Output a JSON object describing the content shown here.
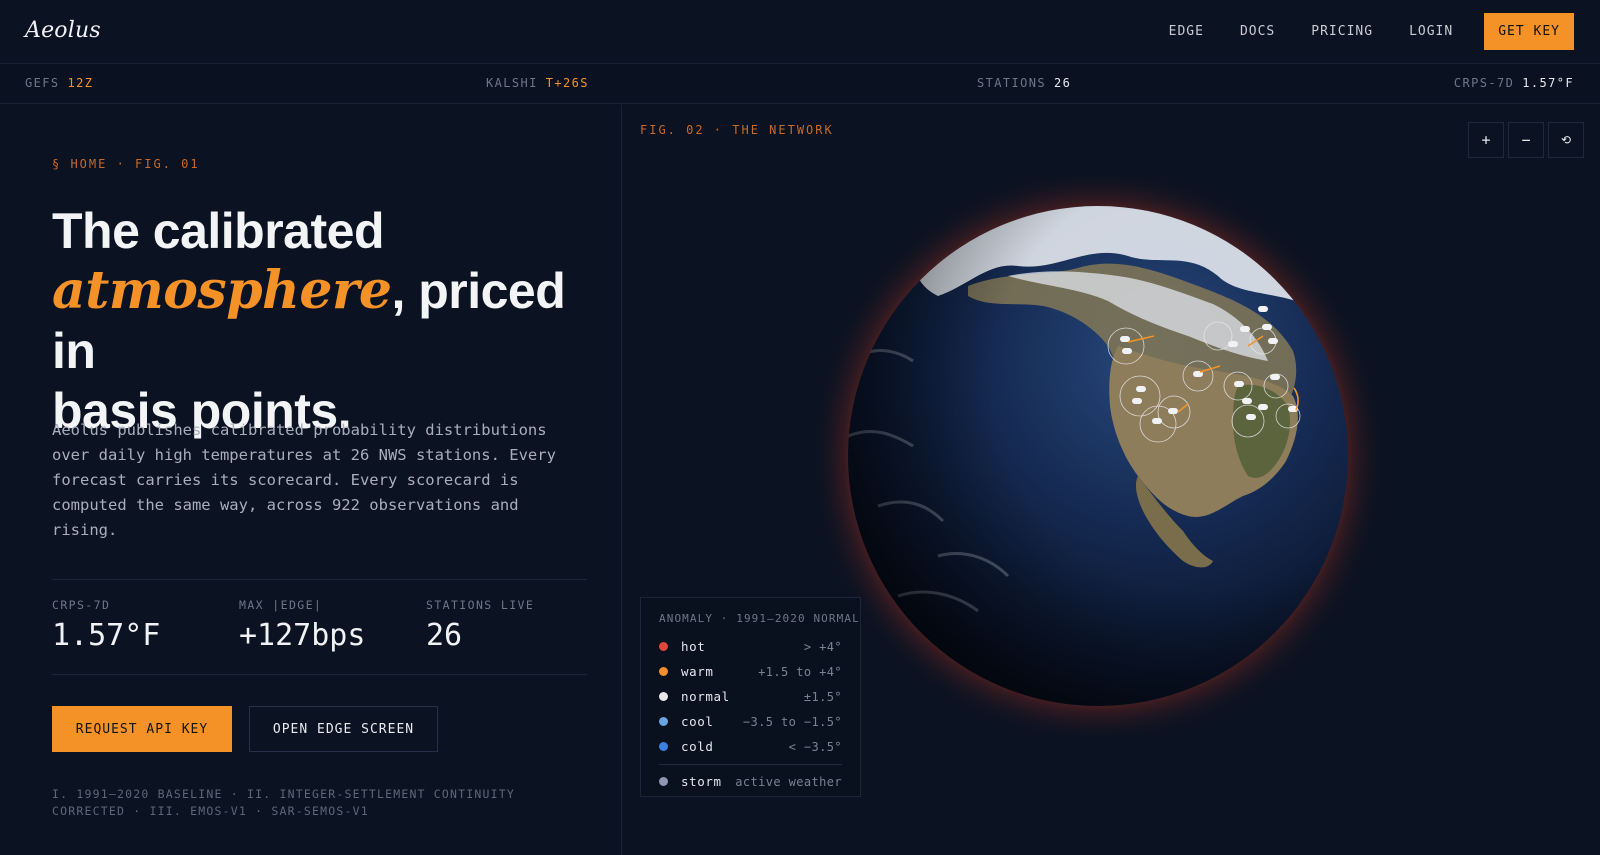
{
  "brand": {
    "logo": "Aeolus"
  },
  "nav": {
    "links": [
      "EDGE",
      "DOCS",
      "PRICING",
      "LOGIN"
    ],
    "cta": "GET KEY",
    "accent_color": "#f59227"
  },
  "ticker": [
    {
      "label": "GEFS",
      "value": "12Z"
    },
    {
      "label": "KALSHI",
      "value": "T+26S"
    },
    {
      "label": "STATIONS",
      "value": "26"
    },
    {
      "label": "CRPS-7D",
      "value": "1.57°F"
    }
  ],
  "hero": {
    "eyebrow": "§ HOME · FIG. 01",
    "headline_line1": "The calibrated",
    "headline_accent": "atmosphere",
    "headline_line2": ", priced in",
    "headline_line3": "basis points.",
    "lede": "Aeolus publishes calibrated probability distributions over daily high temperatures at 26 NWS stations. Every forecast carries its scorecard. Every scorecard is computed the same way, across 922 observations and rising.",
    "stats": [
      {
        "label": "CRPS-7D",
        "value": "1.57°F"
      },
      {
        "label": "MAX |EDGE|",
        "value": "+127bps"
      },
      {
        "label": "STATIONS LIVE",
        "value": "26"
      }
    ],
    "primary_button": "REQUEST API KEY",
    "secondary_button": "OPEN EDGE SCREEN",
    "footnote": "I. 1991–2020 BASELINE · II. INTEGER-SETTLEMENT CONTINUITY CORRECTED · III. EMOS-V1 · SAR-SEMOS-V1"
  },
  "map": {
    "fig_label": "FIG. 02 · THE NETWORK",
    "controls": [
      {
        "icon": "zoom-in-icon",
        "glyph": "+"
      },
      {
        "icon": "zoom-out-icon",
        "glyph": "−"
      },
      {
        "icon": "reset-icon",
        "glyph": "⟲"
      }
    ],
    "legend": {
      "title": "ANOMALY · 1991–2020 NORMAL",
      "items": [
        {
          "name": "hot",
          "range": "> +4°",
          "color": "#e0473a"
        },
        {
          "name": "warm",
          "range": "+1.5 to +4°",
          "color": "#f0902c"
        },
        {
          "name": "normal",
          "range": "±1.5°",
          "color": "#e9e9ec"
        },
        {
          "name": "cool",
          "range": "−3.5 to −1.5°",
          "color": "#6aa4e3"
        },
        {
          "name": "cold",
          "range": "< −3.5°",
          "color": "#3b82e0"
        }
      ],
      "storm": {
        "name": "storm",
        "range": "active weather",
        "color": "#8f97b2"
      }
    }
  }
}
